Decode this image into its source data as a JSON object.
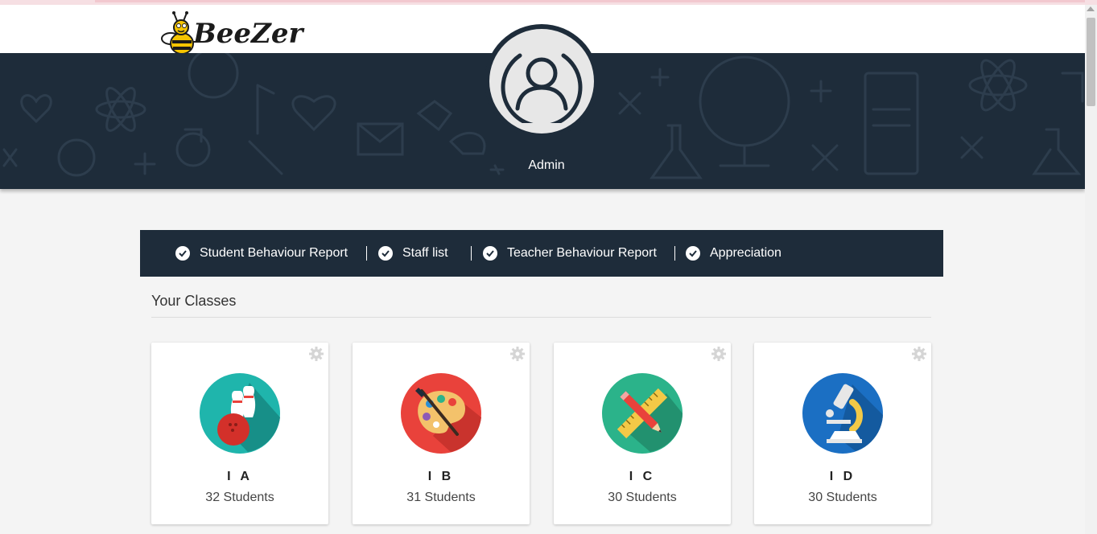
{
  "brand": {
    "name": "BeeZer"
  },
  "profile": {
    "name": "Admin",
    "icon": "user-icon"
  },
  "nav": {
    "items": [
      {
        "label": "Student Behaviour Report",
        "icon": "check-circle-icon"
      },
      {
        "label": "Staff list",
        "icon": "check-circle-icon"
      },
      {
        "label": "Teacher Behaviour Report",
        "icon": "check-circle-icon"
      },
      {
        "label": "Appreciation",
        "icon": "check-circle-icon"
      }
    ]
  },
  "classes": {
    "title": "Your Classes",
    "items": [
      {
        "name": "I A",
        "count": "32 Students",
        "icon": "bowling-icon",
        "color": "#1fb5ac"
      },
      {
        "name": "I B",
        "count": "31 Students",
        "icon": "paint-palette-icon",
        "color": "#e9423b"
      },
      {
        "name": "I C",
        "count": "30 Students",
        "icon": "ruler-pencil-icon",
        "color": "#2bb38a"
      },
      {
        "name": "I D",
        "count": "30 Students",
        "icon": "microscope-icon",
        "color": "#1b6fc3"
      }
    ]
  },
  "colors": {
    "navy": "#1e2c3a",
    "background": "#f4f4f4"
  }
}
